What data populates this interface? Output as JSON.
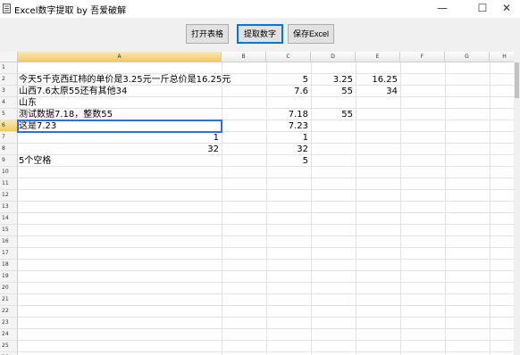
{
  "window": {
    "title": "Excel数字提取 by 吾爱破解",
    "minimize": "—",
    "maximize": "☐",
    "close": "✕"
  },
  "toolbar": {
    "open_label": "打开表格",
    "extract_label": "提取数字",
    "save_label": "保存Excel"
  },
  "sheet": {
    "columns": [
      "A",
      "B",
      "C",
      "D",
      "E",
      "F",
      "G",
      "H"
    ],
    "active_column": "A",
    "active_row": 6,
    "row_numbers": [
      "1",
      "2",
      "3",
      "4",
      "5",
      "6",
      "7",
      "8",
      "9",
      "10",
      "11",
      "12",
      "13",
      "14",
      "15",
      "16",
      "17",
      "18",
      "19",
      "20",
      "21",
      "22",
      "23",
      "24",
      "25",
      "26"
    ],
    "cells": {
      "a2": "今天5千克西红柿的单价是3.25元一斤总价是16.25元",
      "c2": "5",
      "d2": "3.25",
      "e2": "16.25",
      "a3": "山西7.6太原55还有其他34",
      "c3": "7.6",
      "d3": "55",
      "e3": "34",
      "a4": "山东",
      "a5": "测试数据7.18，整数55",
      "c5": "7.18",
      "d5": "55",
      "a6": "这是7.23",
      "c6": "7.23",
      "a7": "1",
      "c7": "1",
      "a8": "32",
      "c8": "32",
      "a9": "5个空格",
      "c9": "5"
    }
  }
}
